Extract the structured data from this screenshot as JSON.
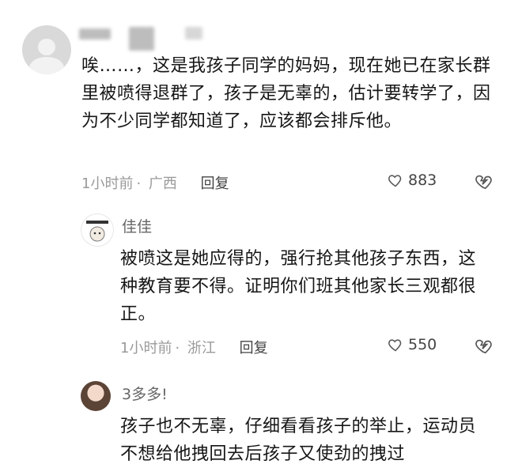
{
  "comments": [
    {
      "name_obscured": true,
      "text": "唉……，这是我孩子同学的妈妈，现在她已在家长群里被喷得退群了，孩子是无辜的，估计要转学了，因为不少同学都知道了，应该都会排斥他。",
      "time": "1小时前",
      "location": "广西",
      "reply_label": "回复",
      "likes": "883",
      "avatar_icon": "default-user-icon"
    },
    {
      "name": "佳佳",
      "text": "被喷这是她应得的，强行抢其他孩子东西，这种教育要不得。证明你们班其他家长三观都很正。",
      "time": "1小时前",
      "location": "浙江",
      "reply_label": "回复",
      "likes": "550",
      "avatar_icon": "cat-avatar-icon"
    },
    {
      "name": "3多多!",
      "text": "孩子也不无辜，仔细看看孩子的举止，运动员不想给他拽回去后孩子又使劲的拽过",
      "avatar_icon": "photo-avatar-icon"
    }
  ],
  "colors": {
    "text": "#161616",
    "meta": "#9a9a9a",
    "name": "#666666"
  }
}
